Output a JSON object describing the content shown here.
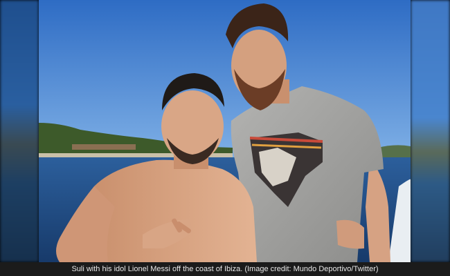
{
  "photo": {
    "description_icon": "photo-icon",
    "colors": {
      "sky": "#3d7fd0",
      "sea": "#1e4a86",
      "shirt": "#9a9a98",
      "skin": "#d9a484",
      "caption_bg": "#1b1b1b",
      "caption_text": "#e9e9e9"
    }
  },
  "caption": {
    "text": "Suli with his idol Lionel Messi off the coast of Ibiza. (Image credit: Mundo Deportivo/Twitter)"
  }
}
